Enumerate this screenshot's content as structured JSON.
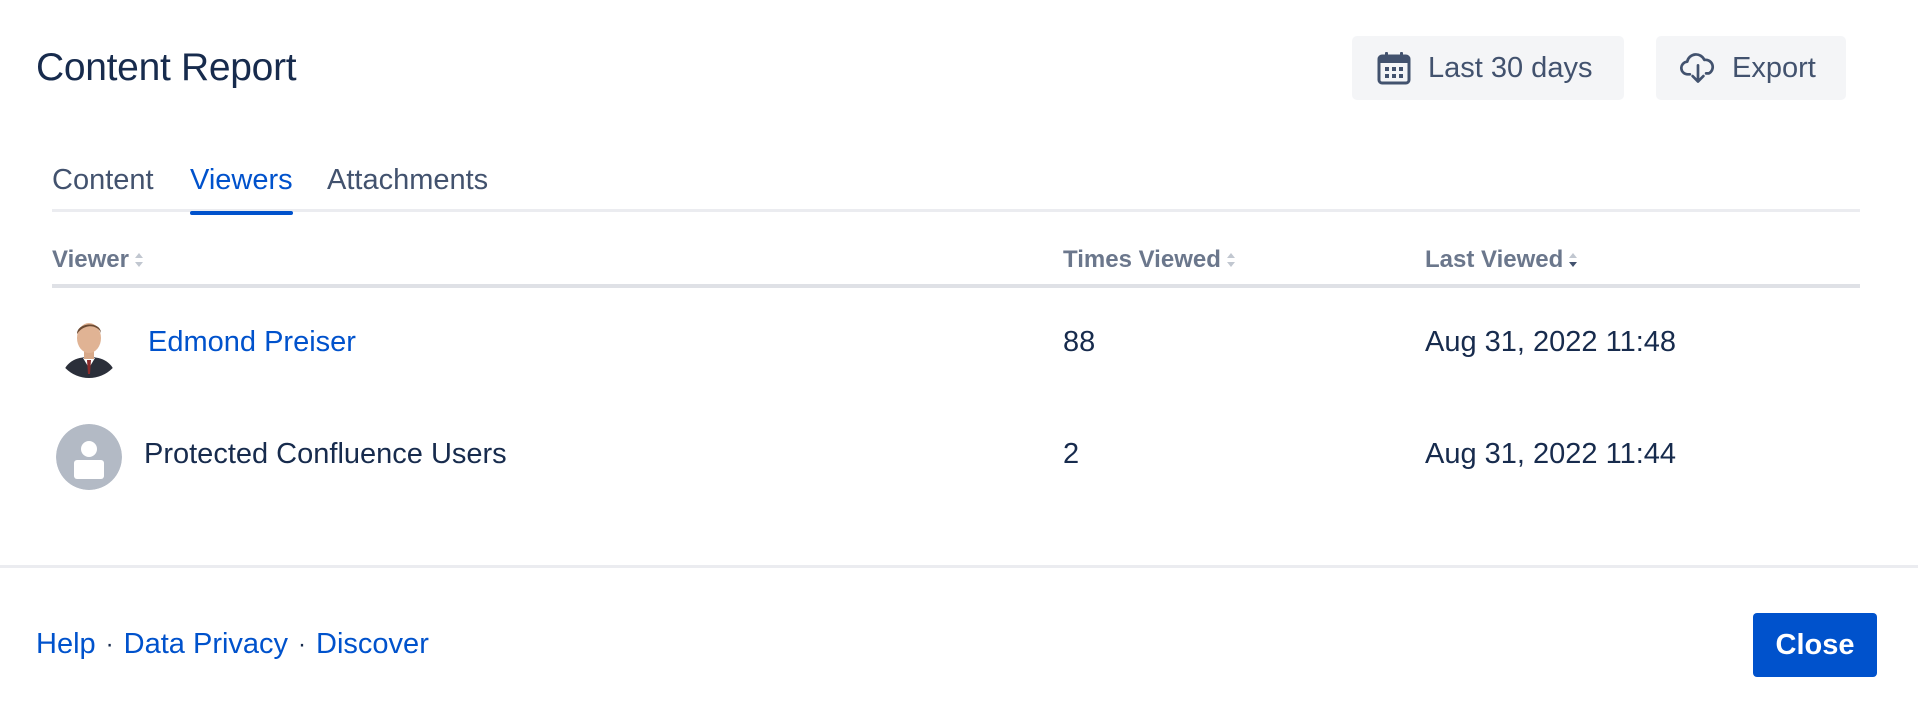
{
  "header": {
    "title": "Content Report",
    "date_range_label": "Last 30 days",
    "export_label": "Export"
  },
  "tabs": [
    {
      "label": "Content",
      "active": false
    },
    {
      "label": "Viewers",
      "active": true
    },
    {
      "label": "Attachments",
      "active": false
    }
  ],
  "table": {
    "columns": [
      "Viewer",
      "Times Viewed",
      "Last Viewed"
    ],
    "sorted_column": "Last Viewed",
    "sort_direction": "descending",
    "rows": [
      {
        "viewer": "Edmond Preiser",
        "times_viewed": "88",
        "last_viewed": "Aug 31, 2022 11:48",
        "avatar": "user-photo-icon",
        "is_link": true
      },
      {
        "viewer": "Protected Confluence Users",
        "times_viewed": "2",
        "last_viewed": "Aug 31, 2022 11:44",
        "avatar": "default-user-icon",
        "is_link": false
      }
    ]
  },
  "footer": {
    "links": [
      "Help",
      "Data Privacy",
      "Discover"
    ],
    "separator": "·",
    "close_label": "Close"
  },
  "colors": {
    "accent": "#0052cc",
    "text": "#172b4d",
    "muted": "#6b778c",
    "button_bg": "#f4f5f7",
    "divider": "#ebecf0"
  }
}
